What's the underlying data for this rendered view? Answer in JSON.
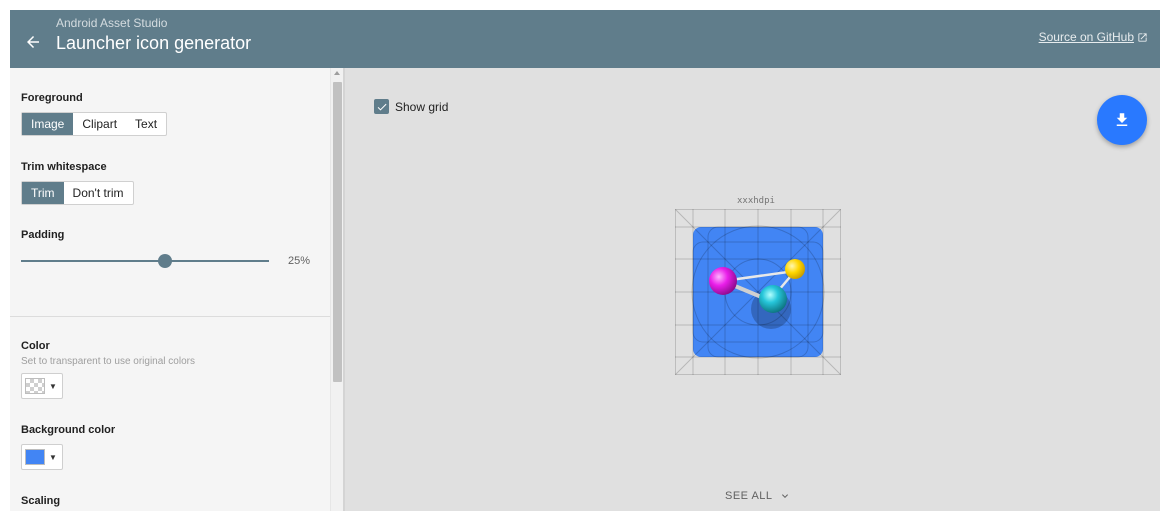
{
  "header": {
    "subtitle": "Android Asset Studio",
    "title": "Launcher icon generator",
    "github_link": "Source on GitHub"
  },
  "sidebar": {
    "foreground": {
      "label": "Foreground",
      "options": [
        "Image",
        "Clipart",
        "Text"
      ],
      "selected": "Image"
    },
    "trim": {
      "label": "Trim whitespace",
      "options": [
        "Trim",
        "Don't trim"
      ],
      "selected": "Trim"
    },
    "padding": {
      "label": "Padding",
      "value_label": "25%",
      "fraction": 0.58
    },
    "color": {
      "label": "Color",
      "help": "Set to transparent to use original colors",
      "swatch": "transparent"
    },
    "background_color": {
      "label": "Background color",
      "swatch": "#4285f4"
    },
    "scaling": {
      "label": "Scaling"
    }
  },
  "preview": {
    "show_grid_label": "Show grid",
    "show_grid_checked": true,
    "density_label": "xxxhdpi",
    "see_all_label": "SEE ALL",
    "icon_background": "#4285f4"
  },
  "colors": {
    "header": "#607d8b",
    "accent": "#2979ff",
    "atom_magenta": "#e91ee9",
    "atom_yellow": "#ffd600",
    "atom_cyan": "#26c6da"
  },
  "icons": {
    "back": "arrow-left-icon",
    "external": "external-link-icon",
    "download": "download-icon",
    "see_all": "chevron-down-icon",
    "check": "check-icon"
  }
}
